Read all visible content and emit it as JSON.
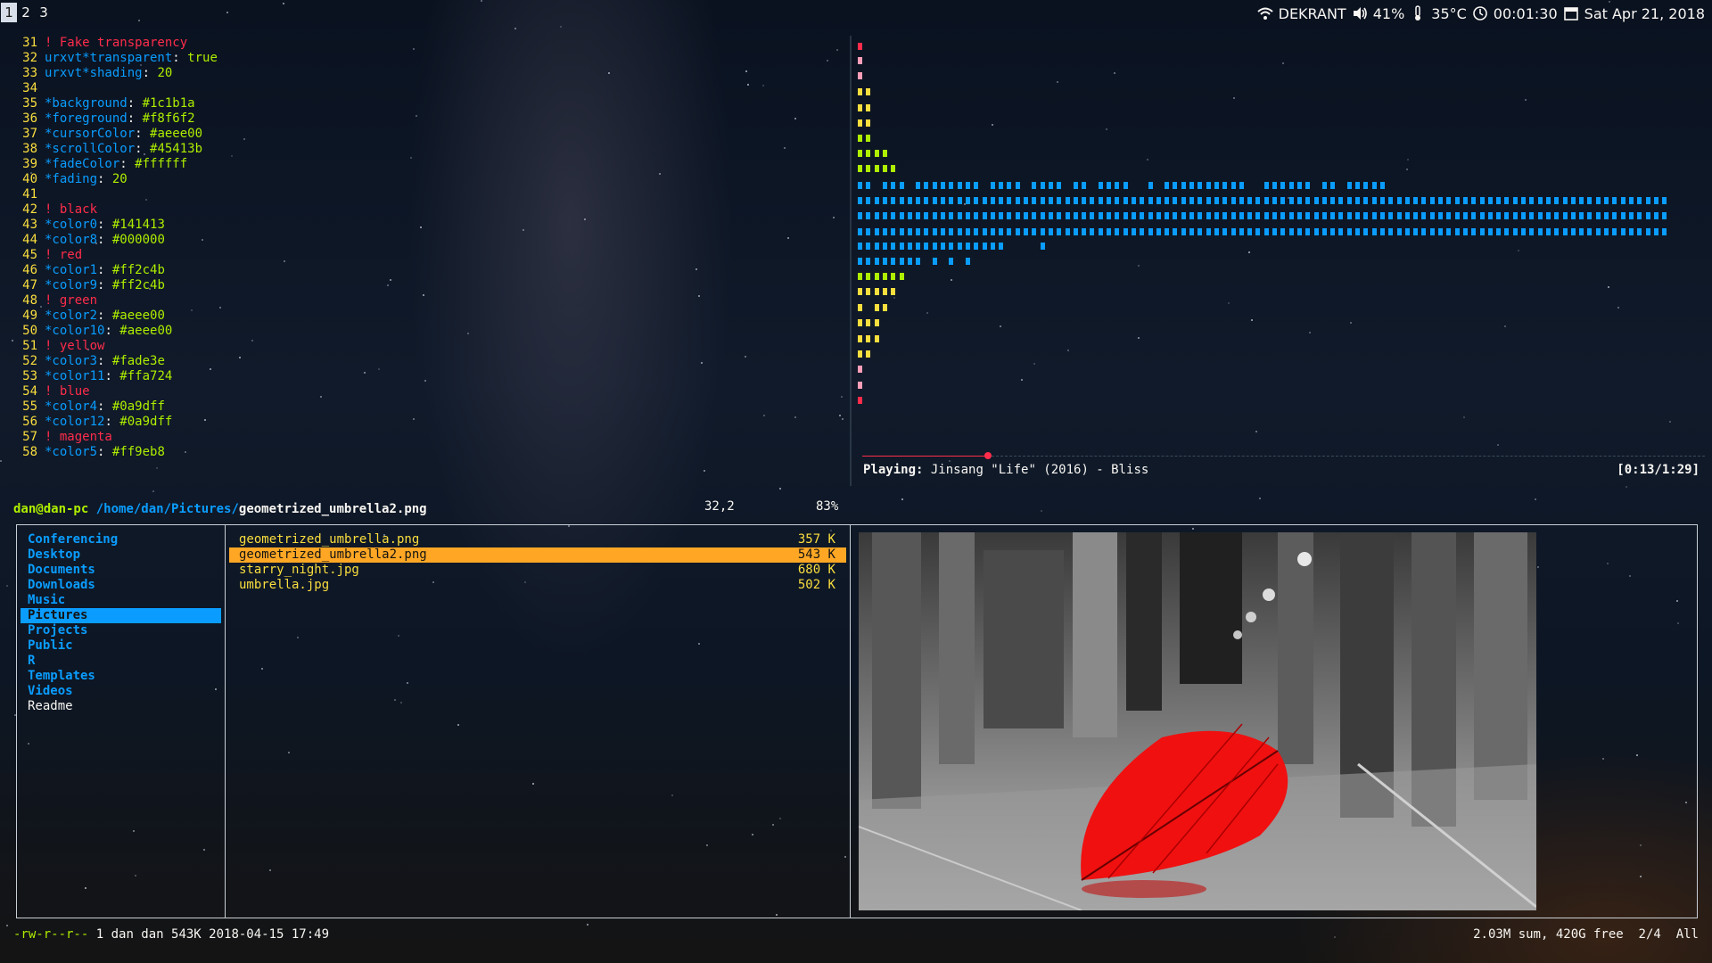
{
  "topbar": {
    "workspaces": [
      "1",
      "2",
      "3"
    ],
    "active_workspace": "1",
    "wifi_name": "DEKRANT",
    "volume": "41%",
    "temperature": "35°C",
    "clock": "00:01:30",
    "date": "Sat Apr 21, 2018",
    "icons": [
      "wifi-icon",
      "volume-icon",
      "thermometer-icon",
      "clock-icon",
      "calendar-icon"
    ]
  },
  "editor": {
    "lines": [
      {
        "num": "31",
        "kind": "comment",
        "text": "! Fake transparency"
      },
      {
        "num": "32",
        "kind": "kv",
        "key": "urxvt*transparent",
        "value": "true"
      },
      {
        "num": "33",
        "kind": "kv",
        "key": "urxvt*shading",
        "value": "20"
      },
      {
        "num": "34",
        "kind": "empty",
        "text": ""
      },
      {
        "num": "35",
        "kind": "kv",
        "key": "*background",
        "value": "#1c1b1a"
      },
      {
        "num": "36",
        "kind": "kv",
        "key": "*foreground",
        "value": "#f8f6f2"
      },
      {
        "num": "37",
        "kind": "kv",
        "key": "*cursorColor",
        "value": "#aeee00"
      },
      {
        "num": "38",
        "kind": "kv",
        "key": "*scrollColor",
        "value": "#45413b"
      },
      {
        "num": "39",
        "kind": "kv",
        "key": "*fadeColor",
        "value": "#ffffff"
      },
      {
        "num": "40",
        "kind": "kv",
        "key": "*fading",
        "value": "20"
      },
      {
        "num": "41",
        "kind": "empty",
        "text": ""
      },
      {
        "num": "42",
        "kind": "comment",
        "text": "! black"
      },
      {
        "num": "43",
        "kind": "kv",
        "key": "*color0",
        "value": "#141413"
      },
      {
        "num": "44",
        "kind": "kv",
        "key": "*color8",
        "value": "#000000"
      },
      {
        "num": "45",
        "kind": "comment",
        "text": "! red"
      },
      {
        "num": "46",
        "kind": "kv",
        "key": "*color1",
        "value": "#ff2c4b"
      },
      {
        "num": "47",
        "kind": "kv",
        "key": "*color9",
        "value": "#ff2c4b"
      },
      {
        "num": "48",
        "kind": "comment",
        "text": "! green"
      },
      {
        "num": "49",
        "kind": "kv",
        "key": "*color2",
        "value": "#aeee00"
      },
      {
        "num": "50",
        "kind": "kv",
        "key": "*color10",
        "value": "#aeee00"
      },
      {
        "num": "51",
        "kind": "comment",
        "text": "! yellow"
      },
      {
        "num": "52",
        "kind": "kv",
        "key": "*color3",
        "value": "#fade3e"
      },
      {
        "num": "53",
        "kind": "kv",
        "key": "*color11",
        "value": "#ffa724"
      },
      {
        "num": "54",
        "kind": "comment",
        "text": "! blue"
      },
      {
        "num": "55",
        "kind": "kv",
        "key": "*color4",
        "value": "#0a9dff"
      },
      {
        "num": "56",
        "kind": "kv",
        "key": "*color12",
        "value": "#0a9dff"
      },
      {
        "num": "57",
        "kind": "comment",
        "text": "! magenta"
      },
      {
        "num": "58",
        "kind": "kv",
        "key": "*color5",
        "value": "#ff9eb8"
      }
    ],
    "cursor_pos": "32,2",
    "scroll_percent": "83%"
  },
  "player": {
    "label": "Playing:",
    "track": "Jinsang \"Life\" (2016) - Bliss",
    "time": "[0:13/1:29]",
    "progress_fraction": 0.146
  },
  "ranger": {
    "user_host": "dan@dan-pc",
    "path": "/home/dan/Pictures/",
    "current_file": "geometrized_umbrella2.png",
    "dirs": [
      {
        "name": "Conferencing",
        "type": "dir"
      },
      {
        "name": "Desktop",
        "type": "dir"
      },
      {
        "name": "Documents",
        "type": "dir"
      },
      {
        "name": "Downloads",
        "type": "dir"
      },
      {
        "name": "Music",
        "type": "dir"
      },
      {
        "name": "Pictures",
        "type": "dir",
        "selected": true
      },
      {
        "name": "Projects",
        "type": "dir"
      },
      {
        "name": "Public",
        "type": "dir"
      },
      {
        "name": "R",
        "type": "dir"
      },
      {
        "name": "Templates",
        "type": "dir"
      },
      {
        "name": "Videos",
        "type": "dir"
      },
      {
        "name": "Readme",
        "type": "file"
      }
    ],
    "files": [
      {
        "name": "geometrized_umbrella.png",
        "size": "357 K"
      },
      {
        "name": "geometrized_umbrella2.png",
        "size": "543 K",
        "selected": true
      },
      {
        "name": "starry_night.jpg",
        "size": "680 K"
      },
      {
        "name": "umbrella.jpg",
        "size": "502 K"
      }
    ],
    "status_perm": "-rw-r--r--",
    "status_info": "1 dan dan 543K 2018-04-15 17:49",
    "status_right": "2.03M sum, 420G free  2/4  All"
  },
  "colors": {
    "red": "#ff2c4b",
    "green": "#aeee00",
    "yellow": "#fade3e",
    "orange": "#ffa724",
    "blue": "#0a9dff",
    "pink": "#ff9eb8"
  }
}
